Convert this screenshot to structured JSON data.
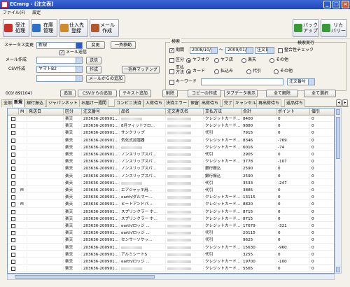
{
  "window": {
    "title": "ECmng - [注文表]"
  },
  "menu": [
    "ファイル(F)",
    "設定"
  ],
  "toolbar": {
    "left_buttons": [
      {
        "label": "受注\n処理",
        "color": "#c8302a"
      },
      {
        "label": "在庫\n管理",
        "color": "#2d6fc4"
      },
      {
        "label": "仕入先\n登録",
        "color": "#d08a2a"
      },
      {
        "label": "メール\n作成",
        "color": "#b45830"
      }
    ],
    "right_buttons": [
      {
        "label": "バック\nアップ",
        "color": "#3a9a3a"
      },
      {
        "label": "リカ\nバリー",
        "color": "#3a9a3a"
      }
    ]
  },
  "filter": {
    "status_label": "ステータス変更",
    "status_value": "新規",
    "change_btn": "変更",
    "bulk_move_btn": "一斉移動",
    "mail_send_label": "メール送信",
    "mail_send_checked": true,
    "mail_create_label": "メール作成",
    "send_btn": "送信",
    "csv_label": "CSV作成",
    "csv_value": "ヤマトB2",
    "create_btn": "作成",
    "add_from_mail_btn": "メールからの追加",
    "bulk_match_btn": "一括再マッチング"
  },
  "search": {
    "group_label": "検索",
    "run_btn": "検索実行",
    "period_label": "期間",
    "period_checked": true,
    "date_from": "2008/10/2",
    "date_sep": "～",
    "date_to": "2009/01/2",
    "date_field": "注文日",
    "consistency_label": "整合性チェック",
    "category_label": "区分",
    "categories": [
      "ヤフオク",
      "ヤフ店",
      "楽天",
      "その他"
    ],
    "payment_label": "支払\n方法",
    "payments": [
      "カード",
      "払込み",
      "代引",
      "その他"
    ],
    "keyword_label": "キーワード",
    "keyword_field": "注文番号"
  },
  "actions": {
    "count": "0(0/ 89(104)",
    "buttons": [
      "追加",
      "CSVからの追加",
      "テキスト追加",
      "削除",
      "コピーの作成",
      "タブデータ表示",
      "全て解除",
      "全て選択"
    ]
  },
  "tabs": [
    "全部",
    "新規",
    "銀行振込",
    "ジャパンネット",
    "お届け一週間",
    "コンビニ決済",
    "入荷待ち",
    "決済エラー",
    "保留",
    "出荷待ち",
    "完了",
    "キャンセル",
    "再出荷待ち",
    "返品待ち"
  ],
  "grid": {
    "columns": [
      "",
      "M",
      "発送日",
      "区分",
      "注文番号",
      "品名",
      "注文者氏名",
      "支払方法",
      "合計",
      "ポイント",
      "値引"
    ],
    "rows": [
      {
        "m": "",
        "kubun": "楽天",
        "order": "203636-200901...",
        "item": "",
        "pay": "クレジットカード...",
        "total": "8400",
        "point": "0",
        "disc": "0"
      },
      {
        "m": "",
        "kubun": "楽天",
        "order": "203636-200901...",
        "item": "8月フィットフロ...",
        "pay": "クレジットカード...",
        "total": "9880",
        "point": "0",
        "disc": "0"
      },
      {
        "m": "",
        "kubun": "楽天",
        "order": "203636-200901...",
        "item": "サンクリップ",
        "pay": "代引",
        "total": "7915",
        "point": "0",
        "disc": "0"
      },
      {
        "m": "",
        "kubun": "楽天",
        "order": "203636-200901...",
        "item": "気化式加湿器",
        "pay": "クレジットカード...",
        "total": "8346",
        "point": "-769",
        "disc": "0"
      },
      {
        "m": "",
        "kubun": "楽天",
        "order": "203636-200901...",
        "item": "",
        "pay": "クレジットカード...",
        "total": "6016",
        "point": "-74",
        "disc": "0"
      },
      {
        "m": "",
        "kubun": "楽天",
        "order": "203636-200901...",
        "item": "ノンスリップスパ...",
        "pay": "代引",
        "total": "2905",
        "point": "0",
        "disc": "0"
      },
      {
        "m": "",
        "kubun": "楽天",
        "order": "203636-200901...",
        "item": "ノンスリップスパ...",
        "pay": "クレジットカード...",
        "total": "3778",
        "point": "-107",
        "disc": "0"
      },
      {
        "m": "",
        "kubun": "楽天",
        "order": "203636-200901...",
        "item": "ノンスリップスパ...",
        "pay": "銀行振込",
        "total": "2590",
        "point": "0",
        "disc": "0"
      },
      {
        "m": "",
        "kubun": "楽天",
        "order": "203636-200901...",
        "item": "ノンスリップスパ...",
        "pay": "銀行振込",
        "total": "2590",
        "point": "0",
        "disc": "0"
      },
      {
        "m": "",
        "kubun": "楽天",
        "order": "203636-200901...",
        "item": "",
        "pay": "代引",
        "total": "3533",
        "point": "-247",
        "disc": "0"
      },
      {
        "m": "M",
        "kubun": "楽天",
        "order": "203636-200901...",
        "item": "エアジャッキ用...",
        "pay": "代引",
        "total": "3885",
        "point": "0",
        "disc": "0"
      },
      {
        "m": "",
        "kubun": "楽天",
        "order": "203636-200901...",
        "item": "earth/ダルマー...",
        "pay": "クレジットカード...",
        "total": "13115",
        "point": "0",
        "disc": "0"
      },
      {
        "m": "M",
        "kubun": "楽天",
        "order": "203636-200901...",
        "item": "ヒートアンドパ...",
        "pay": "クレジットカード...",
        "total": "8820",
        "point": "0",
        "disc": "0"
      },
      {
        "m": "",
        "kubun": "楽天",
        "order": "203636-200901...",
        "item": "スプリンクラー ホ...",
        "pay": "クレジットカード...",
        "total": "8715",
        "point": "0",
        "disc": "0"
      },
      {
        "m": "",
        "kubun": "楽天",
        "order": "203636-200901...",
        "item": "スプリンクラー ホ...",
        "pay": "クレジットカード...",
        "total": "8715",
        "point": "0",
        "disc": "0"
      },
      {
        "m": "",
        "kubun": "楽天",
        "order": "203636-200901...",
        "item": "earth/ロッジ ...",
        "pay": "クレジットカード...",
        "total": "17679",
        "point": "-321",
        "disc": "0"
      },
      {
        "m": "",
        "kubun": "楽天",
        "order": "203636-200901...",
        "item": "earth/ロッジ ...",
        "pay": "代引",
        "total": "20115",
        "point": "0",
        "disc": "0"
      },
      {
        "m": "",
        "kubun": "楽天",
        "order": "203636-200901...",
        "item": "センサーソケッ...",
        "pay": "代引",
        "total": "9625",
        "point": "0",
        "disc": "0"
      },
      {
        "m": "",
        "kubun": "楽天",
        "order": "203636-200901...",
        "item": "",
        "pay": "クレジットカード...",
        "total": "15630",
        "point": "-960",
        "disc": "0"
      },
      {
        "m": "",
        "kubun": "楽天",
        "order": "203636-200901...",
        "item": "アルミシートS",
        "pay": "代引",
        "total": "3255",
        "point": "0",
        "disc": "0"
      },
      {
        "m": "",
        "kubun": "楽天",
        "order": "203636-200901...",
        "item": "earth/ロッジ ...",
        "pay": "クレジットカード...",
        "total": "19700",
        "point": "-100",
        "disc": "0"
      },
      {
        "m": "",
        "kubun": "楽天",
        "order": "203636-200901...",
        "item": "",
        "pay": "クレジットカード...",
        "total": "5565",
        "point": "0",
        "disc": "0"
      }
    ]
  }
}
